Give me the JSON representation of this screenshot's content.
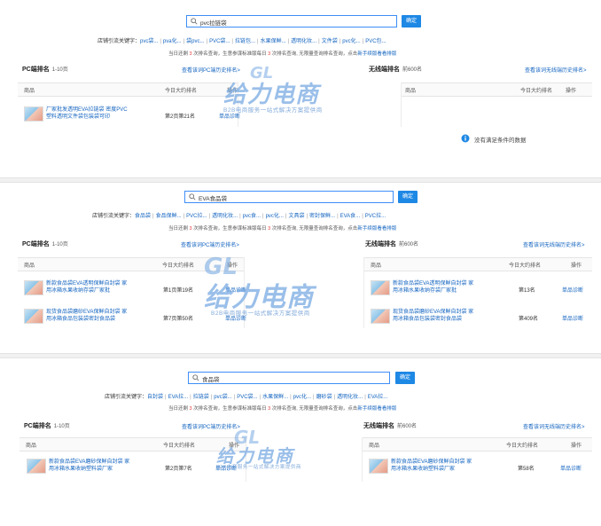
{
  "panels": [
    {
      "search_value": "pvc拉链袋",
      "search_button": "确定",
      "keywords_label": "店铺引流关键字：",
      "keywords": [
        "pvc袋...",
        "pva化...",
        "袋pvc...",
        "PVC袋...",
        "拉链包...",
        "水果保鲜...",
        "透明化妆...",
        "文件袋",
        "pvc化...",
        "PVC包..."
      ],
      "note": {
        "pre": "当日还剩 ",
        "count": "3",
        "mid": " 次排名查询，生意参谋标准版每日 ",
        "count2": "3",
        "post": " 次排名查询, 无限量查询排名查询，点击",
        "link": "新手续版看看排版"
      },
      "pc": {
        "title": "PC端排名",
        "sub": "1-10页",
        "link": "查看该词PC端历史排名>",
        "headers": [
          "商品",
          "今日大约排名",
          "操作"
        ],
        "rows": [
          {
            "name": "厂家批发透明EVA拉链袋 密度PVC塑料透明文件袋包装袋可印",
            "rank": "第2页第21名",
            "action": "单品诊断"
          }
        ]
      },
      "wireless": {
        "title": "无线端排名",
        "sub": "前600名",
        "link": "查看该词无线端历史排名>",
        "headers": [
          "商品",
          "今日大约排名",
          "操作"
        ],
        "empty": "没有满足条件的数据"
      }
    },
    {
      "search_value": "EVA食品袋",
      "search_button": "确定",
      "keywords_label": "店铺引流关键字：",
      "keywords": [
        "食品袋",
        "食品保鲜...",
        "PVC拉...",
        "透明化妆...",
        "pvc食...",
        "pvc化...",
        "文具袋",
        "密封保鲜...",
        "EVA食...",
        "PVC拉..."
      ],
      "note": {
        "pre": "当日还剩 ",
        "count": "3",
        "mid": " 次排名查询，生意参谋标准版每日 ",
        "count2": "3",
        "post": " 次排名查询, 无限量查询排名查询，点击",
        "link": "新手续版看看排版"
      },
      "pc": {
        "title": "PC端排名",
        "sub": "1-10页",
        "link": "查看该词PC端历史排名>",
        "headers": [
          "商品",
          "今日大约排名",
          "操作"
        ],
        "rows": [
          {
            "name": "新款食品袋EVA透明保鲜自封袋 家用冰箱水果收纳存袋厂家批",
            "rank": "第1页第19名",
            "action": "单品诊断"
          },
          {
            "name": "现货食品袋磨砂EVA保鲜自封袋 家用冰箱食品包装袋密封食品袋",
            "rank": "第7页第50名",
            "action": "单品诊断"
          }
        ]
      },
      "wireless": {
        "title": "无线端排名",
        "sub": "前600名",
        "link": "查看该词无线端历史排名>",
        "headers": [
          "商品",
          "今日大约排名",
          "操作"
        ],
        "rows": [
          {
            "name": "新款食品袋EVA透明保鲜自封袋 家用冰箱水果收纳存袋厂家批",
            "rank": "第13名",
            "action": "单品诊断"
          },
          {
            "name": "现货食品袋磨砂EVA保鲜自封袋 家用冰箱食品包装袋密封食品袋",
            "rank": "第409名",
            "action": "单品诊断"
          }
        ]
      }
    },
    {
      "search_value": "食品袋",
      "search_button": "确定",
      "keywords_label": "店铺引流关键字：",
      "keywords": [
        "自封袋",
        "EVA拉...",
        "拉链袋",
        "pvc袋...",
        "PVC袋...",
        "水果保鲜...",
        "pvc化...",
        "磨砂袋",
        "透明化妆...",
        "EVA拉..."
      ],
      "note": {
        "pre": "当日还剩 ",
        "count": "3",
        "mid": " 次排名查询，生意参谋标准版每日 ",
        "count2": "3",
        "post": " 次排名查询, 无限量查询排名查询，点击",
        "link": "新手续版看看排版"
      },
      "pc": {
        "title": "PC端排名",
        "sub": "1-10页",
        "link": "查看该词PC端历史排名>",
        "headers": [
          "商品",
          "今日大约排名",
          "操作"
        ],
        "rows": [
          {
            "name": "新款食品袋EVA磨砂保鲜自封袋 家用冰箱水果收纳塑料袋厂家",
            "rank": "第2页第7名",
            "action": "单品诊断"
          }
        ]
      },
      "wireless": {
        "title": "无线端排名",
        "sub": "前600名",
        "link": "查看该词无线端历史排名>",
        "headers": [
          "商品",
          "今日大约排名",
          "操作"
        ],
        "rows": [
          {
            "name": "新款食品袋EVA磨砂保鲜自封袋 家用冰箱水果收纳塑料袋厂家",
            "rank": "第58名",
            "action": "单品诊断"
          }
        ]
      }
    }
  ],
  "watermark": {
    "logo": "给力电商",
    "tagline": "B2B电商服务一站式解决方案提供商"
  },
  "colors": {
    "accent": "#1e88e5",
    "link": "#1565c0",
    "highlight": "#e53935"
  }
}
